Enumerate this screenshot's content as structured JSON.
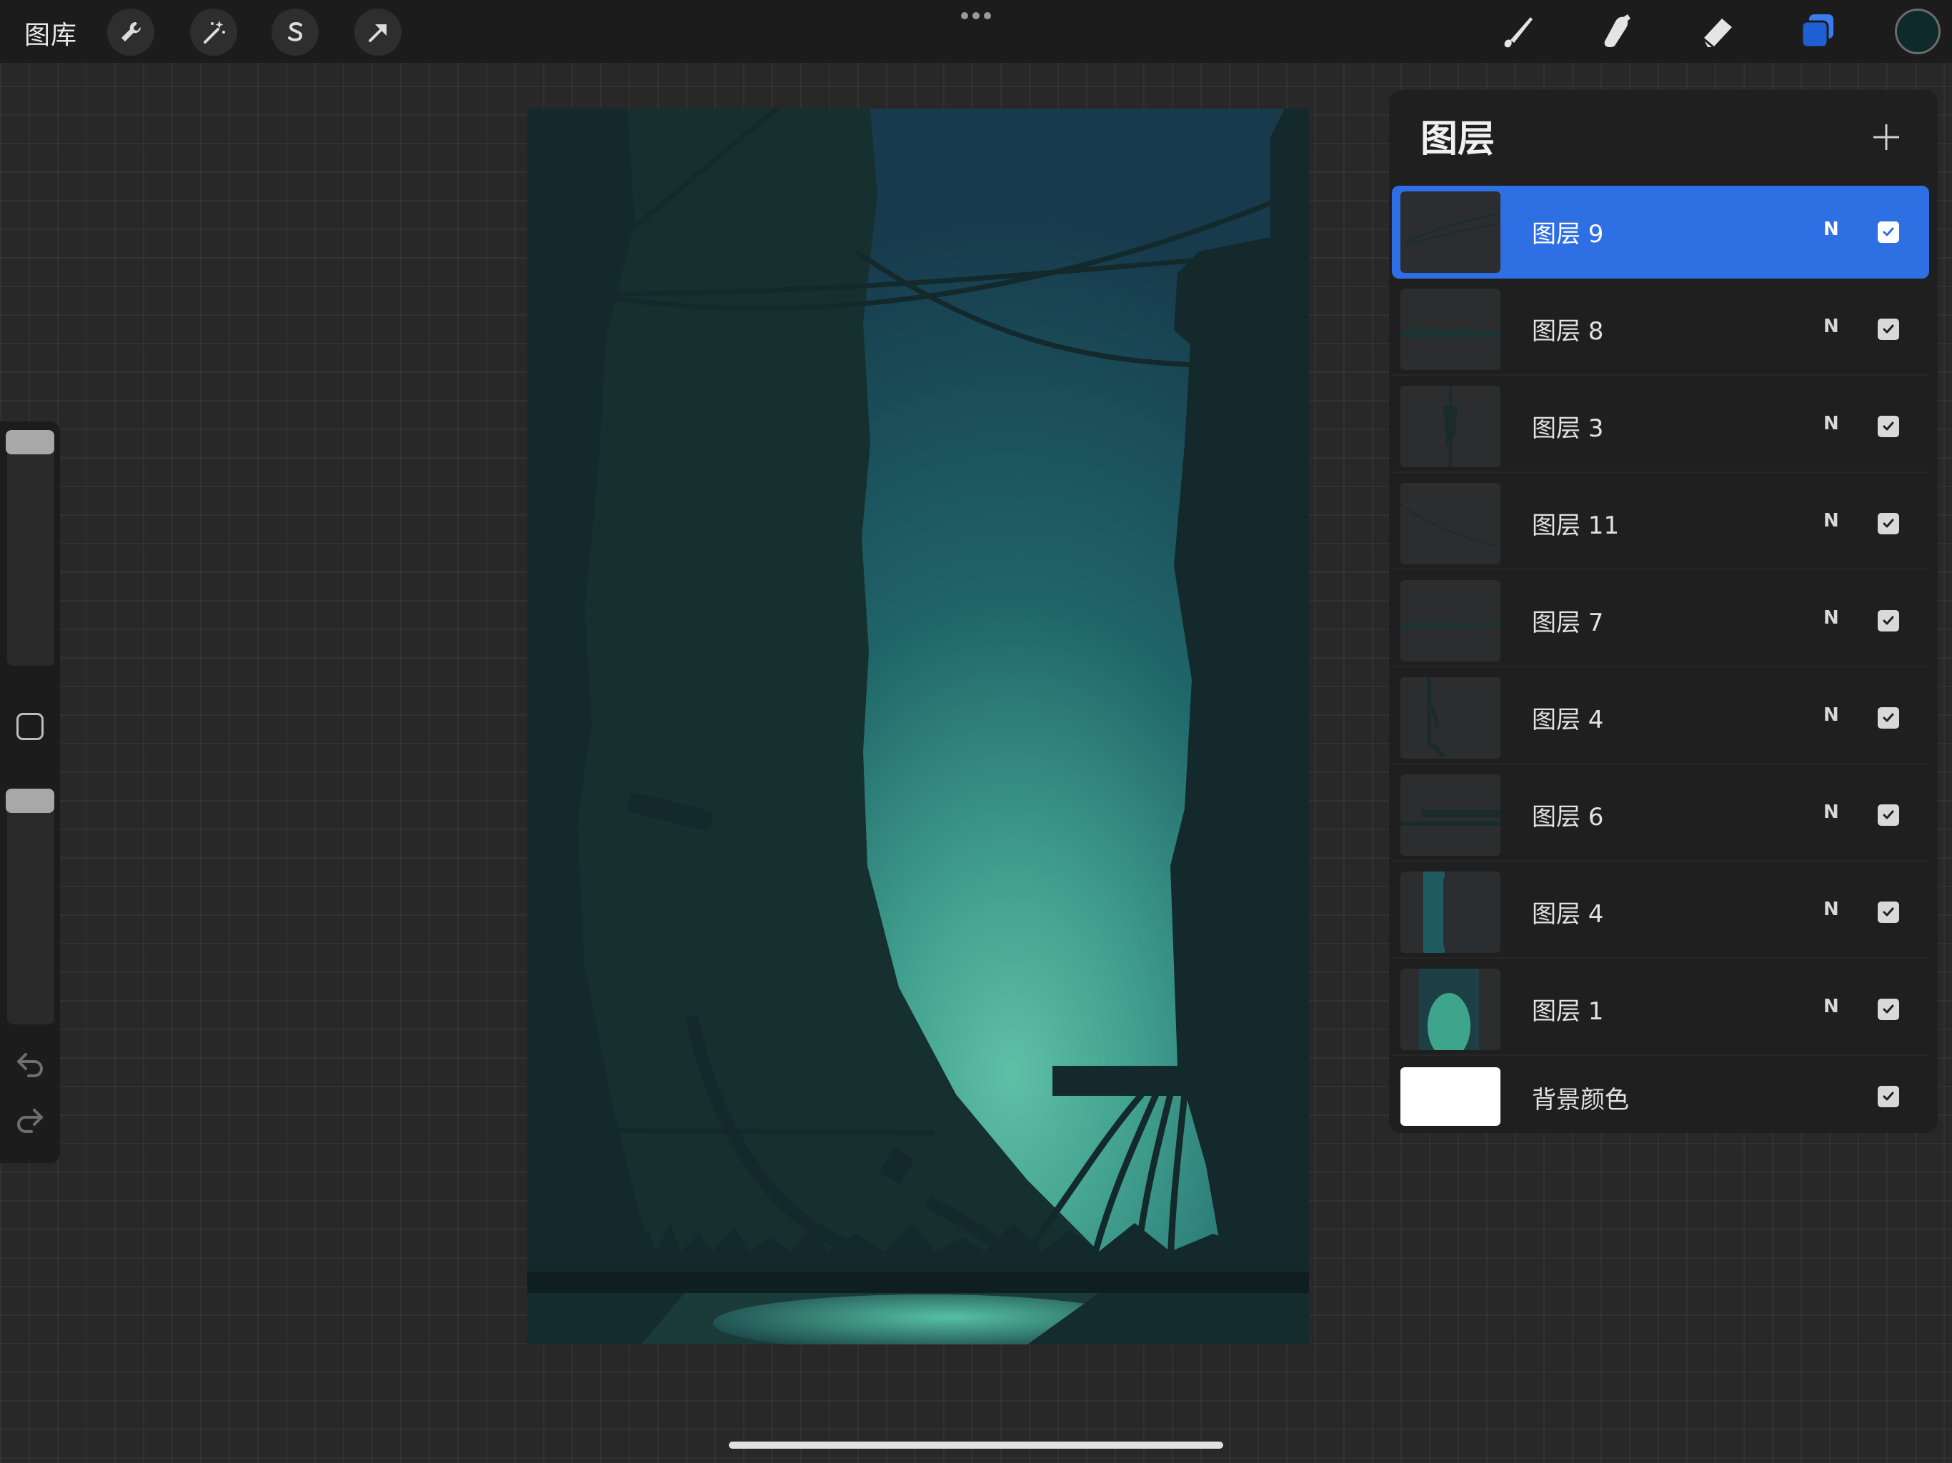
{
  "toolbar": {
    "gallery_label": "图库",
    "left_tools": [
      "wrench-icon",
      "magic-wand-icon",
      "selection-s-icon",
      "arrow-transform-icon"
    ],
    "right_tools": [
      "brush-icon",
      "smudge-icon",
      "eraser-icon",
      "layers-icon"
    ],
    "active_tool": "layers-icon",
    "current_color": "#0f2a2c"
  },
  "sidebar": {
    "brush_size_fraction": 1.0,
    "opacity_fraction": 1.0
  },
  "layers": {
    "title": "图层",
    "add_icon": "plus-icon",
    "items": [
      {
        "name": "图层 9",
        "blend": "N",
        "visible": true,
        "active": true
      },
      {
        "name": "图层 8",
        "blend": "N",
        "visible": true,
        "active": false
      },
      {
        "name": "图层 3",
        "blend": "N",
        "visible": true,
        "active": false
      },
      {
        "name": "图层 11",
        "blend": "N",
        "visible": true,
        "active": false
      },
      {
        "name": "图层 7",
        "blend": "N",
        "visible": true,
        "active": false
      },
      {
        "name": "图层 4",
        "blend": "N",
        "visible": true,
        "active": false
      },
      {
        "name": "图层 6",
        "blend": "N",
        "visible": true,
        "active": false
      },
      {
        "name": "图层 4",
        "blend": "N",
        "visible": true,
        "active": false
      },
      {
        "name": "图层 1",
        "blend": "N",
        "visible": true,
        "active": false
      }
    ],
    "background": {
      "name": "背景颜色",
      "color": "#ffffff",
      "visible": true
    }
  },
  "colors": {
    "accent": "#2f6fe4",
    "canvas_glow": "#5fc0a8",
    "silhouette": "#13292b"
  }
}
